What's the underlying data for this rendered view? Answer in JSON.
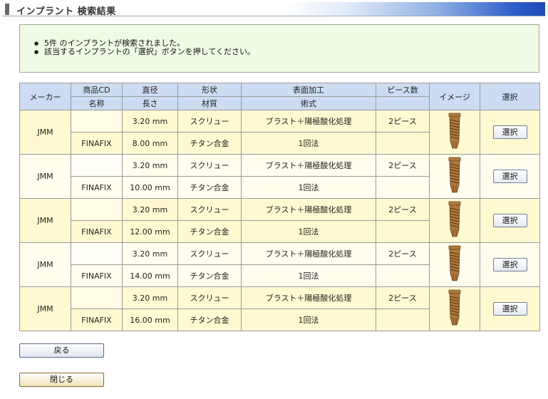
{
  "page": {
    "title": "インプラント 検索結果"
  },
  "messages": [
    "5件 のインプラントが検索されました。",
    "該当するインプラントの「選択」ボタンを押してください。"
  ],
  "table": {
    "headers": {
      "maker": "メーカー",
      "product_code": "商品CD",
      "name": "名称",
      "diameter": "直径",
      "length": "長さ",
      "shape": "形状",
      "material": "材質",
      "surface": "表面加工",
      "technique": "術式",
      "pieces": "ピース数",
      "image": "イメージ",
      "select": "選択"
    },
    "rows": [
      {
        "maker": "JMM",
        "product_code": "",
        "name": "FINAFIX",
        "diameter": "3.20 mm",
        "length": "8.00 mm",
        "shape": "スクリュー",
        "material": "チタン合金",
        "surface": "ブラスト＋陽極酸化処理",
        "technique": "1回法",
        "pieces": "2ピース",
        "select_label": "選択"
      },
      {
        "maker": "JMM",
        "product_code": "",
        "name": "FINAFIX",
        "diameter": "3.20 mm",
        "length": "10.00 mm",
        "shape": "スクリュー",
        "material": "チタン合金",
        "surface": "ブラスト＋陽極酸化処理",
        "technique": "1回法",
        "pieces": "2ピース",
        "select_label": "選択"
      },
      {
        "maker": "JMM",
        "product_code": "",
        "name": "FINAFIX",
        "diameter": "3.20 mm",
        "length": "12.00 mm",
        "shape": "スクリュー",
        "material": "チタン合金",
        "surface": "ブラスト＋陽極酸化処理",
        "technique": "1回法",
        "pieces": "2ピース",
        "select_label": "選択"
      },
      {
        "maker": "JMM",
        "product_code": "",
        "name": "FINAFIX",
        "diameter": "3.20 mm",
        "length": "14.00 mm",
        "shape": "スクリュー",
        "material": "チタン合金",
        "surface": "ブラスト＋陽極酸化処理",
        "technique": "1回法",
        "pieces": "2ピース",
        "select_label": "選択"
      },
      {
        "maker": "JMM",
        "product_code": "",
        "name": "FINAFIX",
        "diameter": "3.20 mm",
        "length": "16.00 mm",
        "shape": "スクリュー",
        "material": "チタン合金",
        "surface": "ブラスト＋陽極酸化処理",
        "technique": "1回法",
        "pieces": "2ピース",
        "select_label": "選択"
      }
    ]
  },
  "buttons": {
    "back": "戻る",
    "close": "閉じる"
  },
  "colors": {
    "header_bg": "#ccdcf2",
    "row_odd_bg": "#fff9d1",
    "row_even_bg": "#fffded",
    "info_bg": "#effbe4",
    "title_gradient_end": "#1e49b8",
    "implant_color": "#b07a3c"
  },
  "icons": {
    "implant": "dental-implant-icon"
  }
}
